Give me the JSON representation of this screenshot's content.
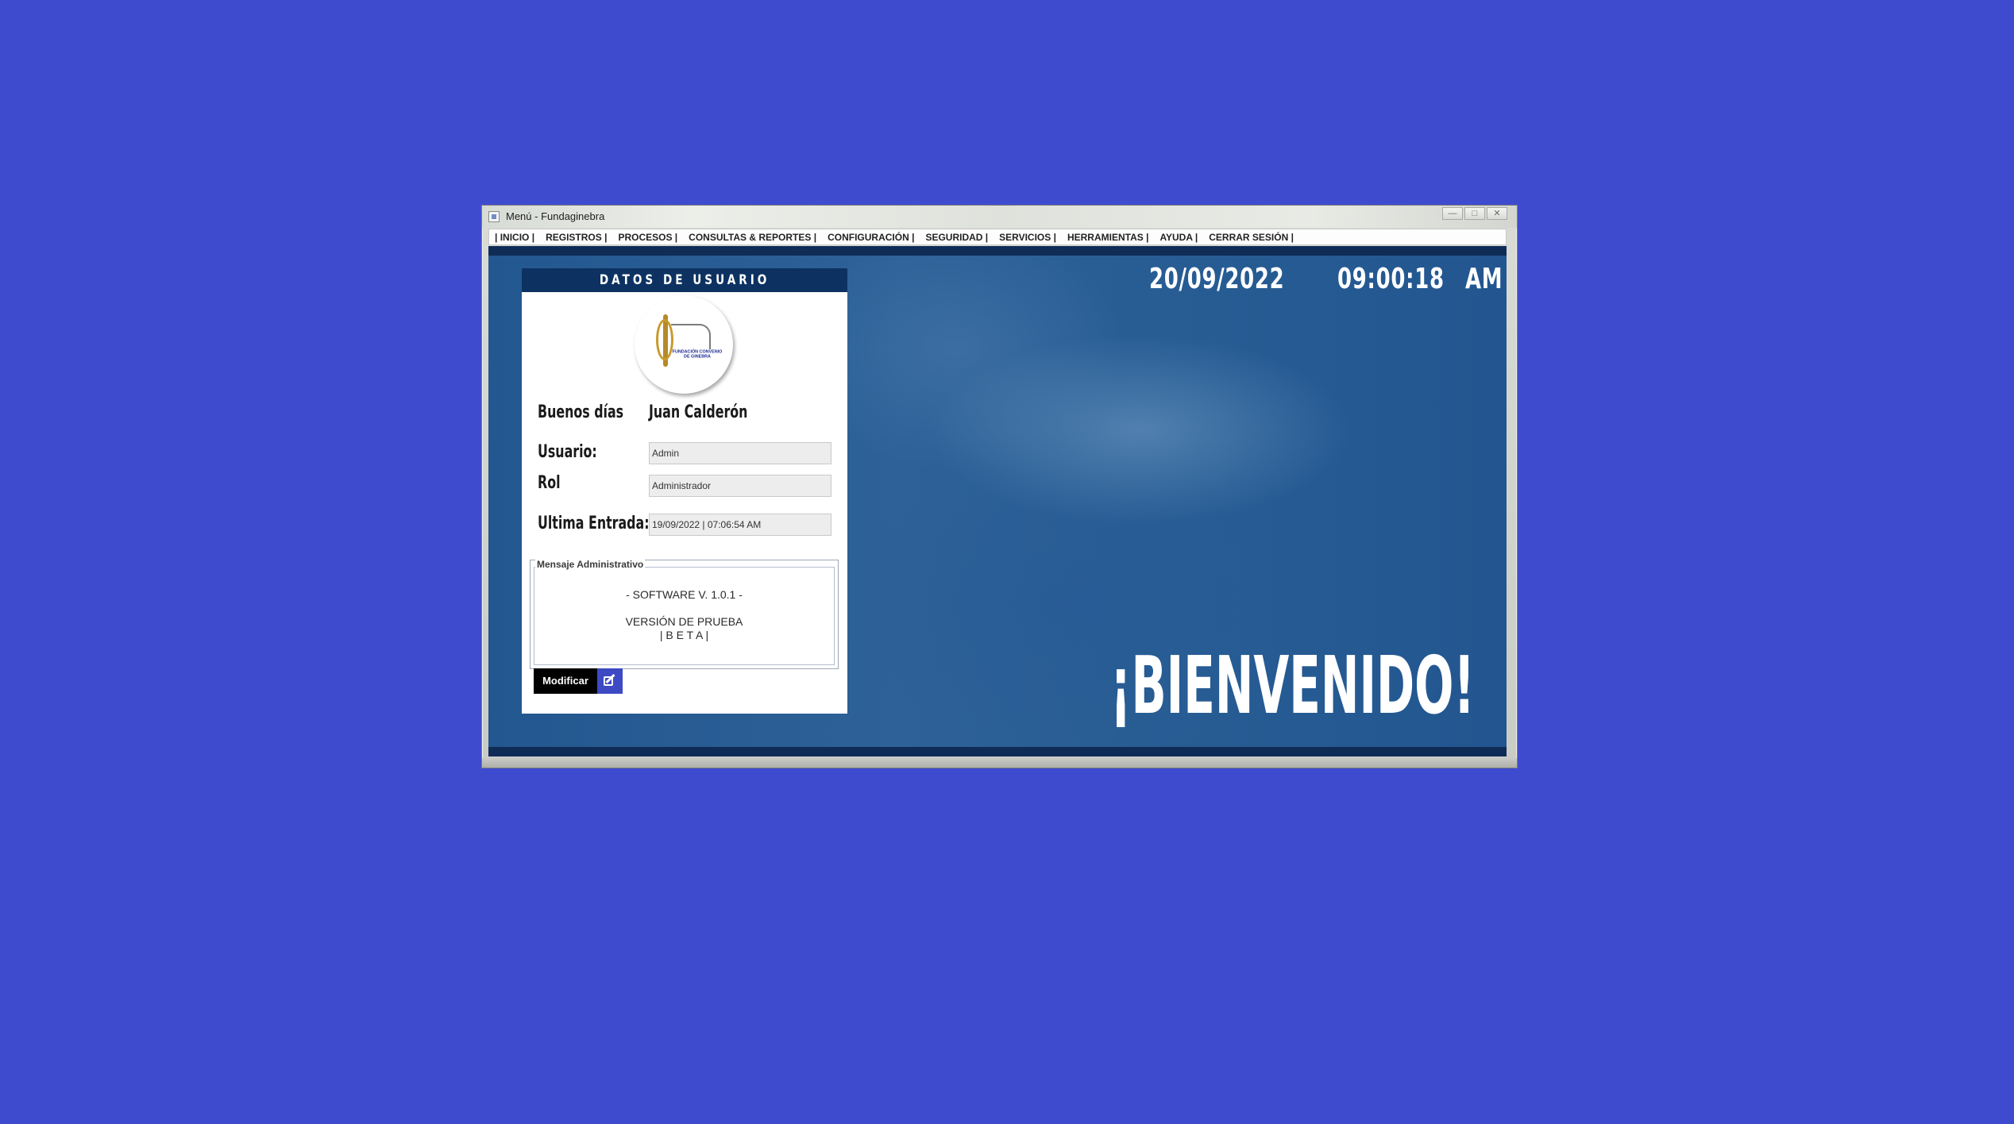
{
  "window": {
    "title": "Menú - Fundaginebra",
    "controls": [
      "minimize",
      "maximize",
      "close"
    ]
  },
  "menu": {
    "items": [
      "| INICIO |",
      "REGISTROS |",
      "PROCESOS |",
      "CONSULTAS & REPORTES |",
      "CONFIGURACIÓN |",
      "SEGURIDAD |",
      "SERVICIOS |",
      "HERRAMIENTAS |",
      "AYUDA |",
      "CERRAR SESIÓN |"
    ]
  },
  "clock": {
    "date": "20/09/2022",
    "time": "09:00:18",
    "ampm": "AM"
  },
  "welcome_text": "¡BIENVENIDO!",
  "user_panel": {
    "header": "DATOS DE USUARIO",
    "logo_text": "FUNDACIÓN CONVENIO DE GINEBRA",
    "greeting_label": "Buenos días",
    "user_name": "Juan Calderón",
    "usuario_label": "Usuario:",
    "usuario_value": "Admin",
    "rol_label": "Rol",
    "rol_value": "Administrador",
    "last_login_label": "Ultima Entrada:",
    "last_login_value": "19/09/2022 | 07:06:54 AM",
    "message": {
      "legend": "Mensaje Administrativo",
      "line1": "- SOFTWARE V. 1.0.1 -",
      "line2": "VERSIÓN DE PRUEBA",
      "line3": "| B E T A |"
    },
    "modify_button": "Modificar"
  },
  "colors": {
    "desktop": "#3f4bcf",
    "panel_header": "#0d3262",
    "content_bg": "#2a5d94",
    "modify_icon_bg": "#3e49c4"
  },
  "icons": {
    "app": "java-app-icon",
    "edit": "edit-icon"
  }
}
